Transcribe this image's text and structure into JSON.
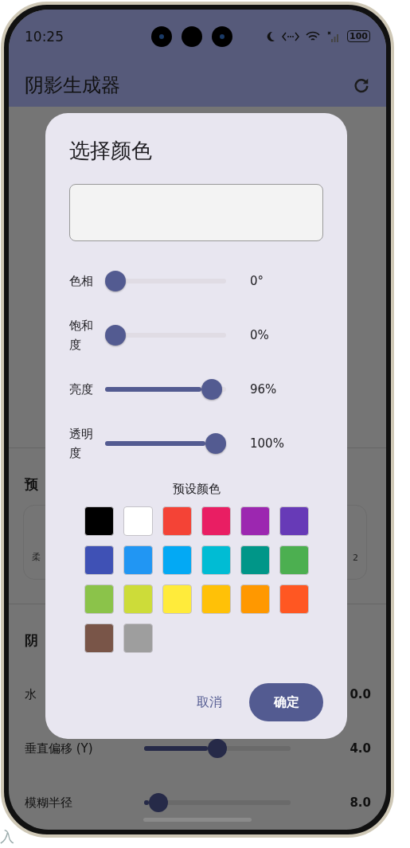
{
  "status_bar": {
    "time": "10:25",
    "battery": "100"
  },
  "app_bar": {
    "title": "阴影生成器"
  },
  "background": {
    "presets_heading": "预",
    "preset_cards": [
      {
        "label": "柔"
      },
      {
        "label": "2"
      }
    ],
    "shadow_heading": "阴",
    "controls": [
      {
        "label": "水",
        "reading": "0.0"
      },
      {
        "label": "垂直偏移 (Y)",
        "level": 0.5,
        "reading": "4.0"
      },
      {
        "label": "模糊半径",
        "level": 0.04,
        "reading": "8.0"
      }
    ]
  },
  "dialog": {
    "title": "选择颜色",
    "sliders": [
      {
        "label": "色相",
        "level": 0,
        "reading": "0°"
      },
      {
        "label": "饱和度",
        "level": 0,
        "reading": "0%"
      },
      {
        "label": "亮度",
        "level": 0.96,
        "reading": "96%"
      },
      {
        "label": "透明度",
        "level": 1,
        "reading": "100%"
      }
    ],
    "presets_title": "预设颜色",
    "swatches": [
      {
        "color": "#000000"
      },
      {
        "color": "#ffffff"
      },
      {
        "color": "#f44336"
      },
      {
        "color": "#e91e63"
      },
      {
        "color": "#9c27b0"
      },
      {
        "color": "#673ab7"
      },
      {
        "color": "#3f51b5"
      },
      {
        "color": "#2196f3"
      },
      {
        "color": "#03a9f4"
      },
      {
        "color": "#00bcd4"
      },
      {
        "color": "#009688"
      },
      {
        "color": "#4caf50"
      },
      {
        "color": "#8bc34a"
      },
      {
        "color": "#cddc39"
      },
      {
        "color": "#ffeb3b"
      },
      {
        "color": "#ffc107"
      },
      {
        "color": "#ff9800"
      },
      {
        "color": "#ff5722"
      },
      {
        "color": "#795548"
      },
      {
        "color": "#9e9e9e"
      }
    ],
    "buttons": [
      {
        "label": "取消",
        "kind": "text"
      },
      {
        "label": "确定",
        "kind": "filled"
      }
    ]
  },
  "page_fragment": "入"
}
